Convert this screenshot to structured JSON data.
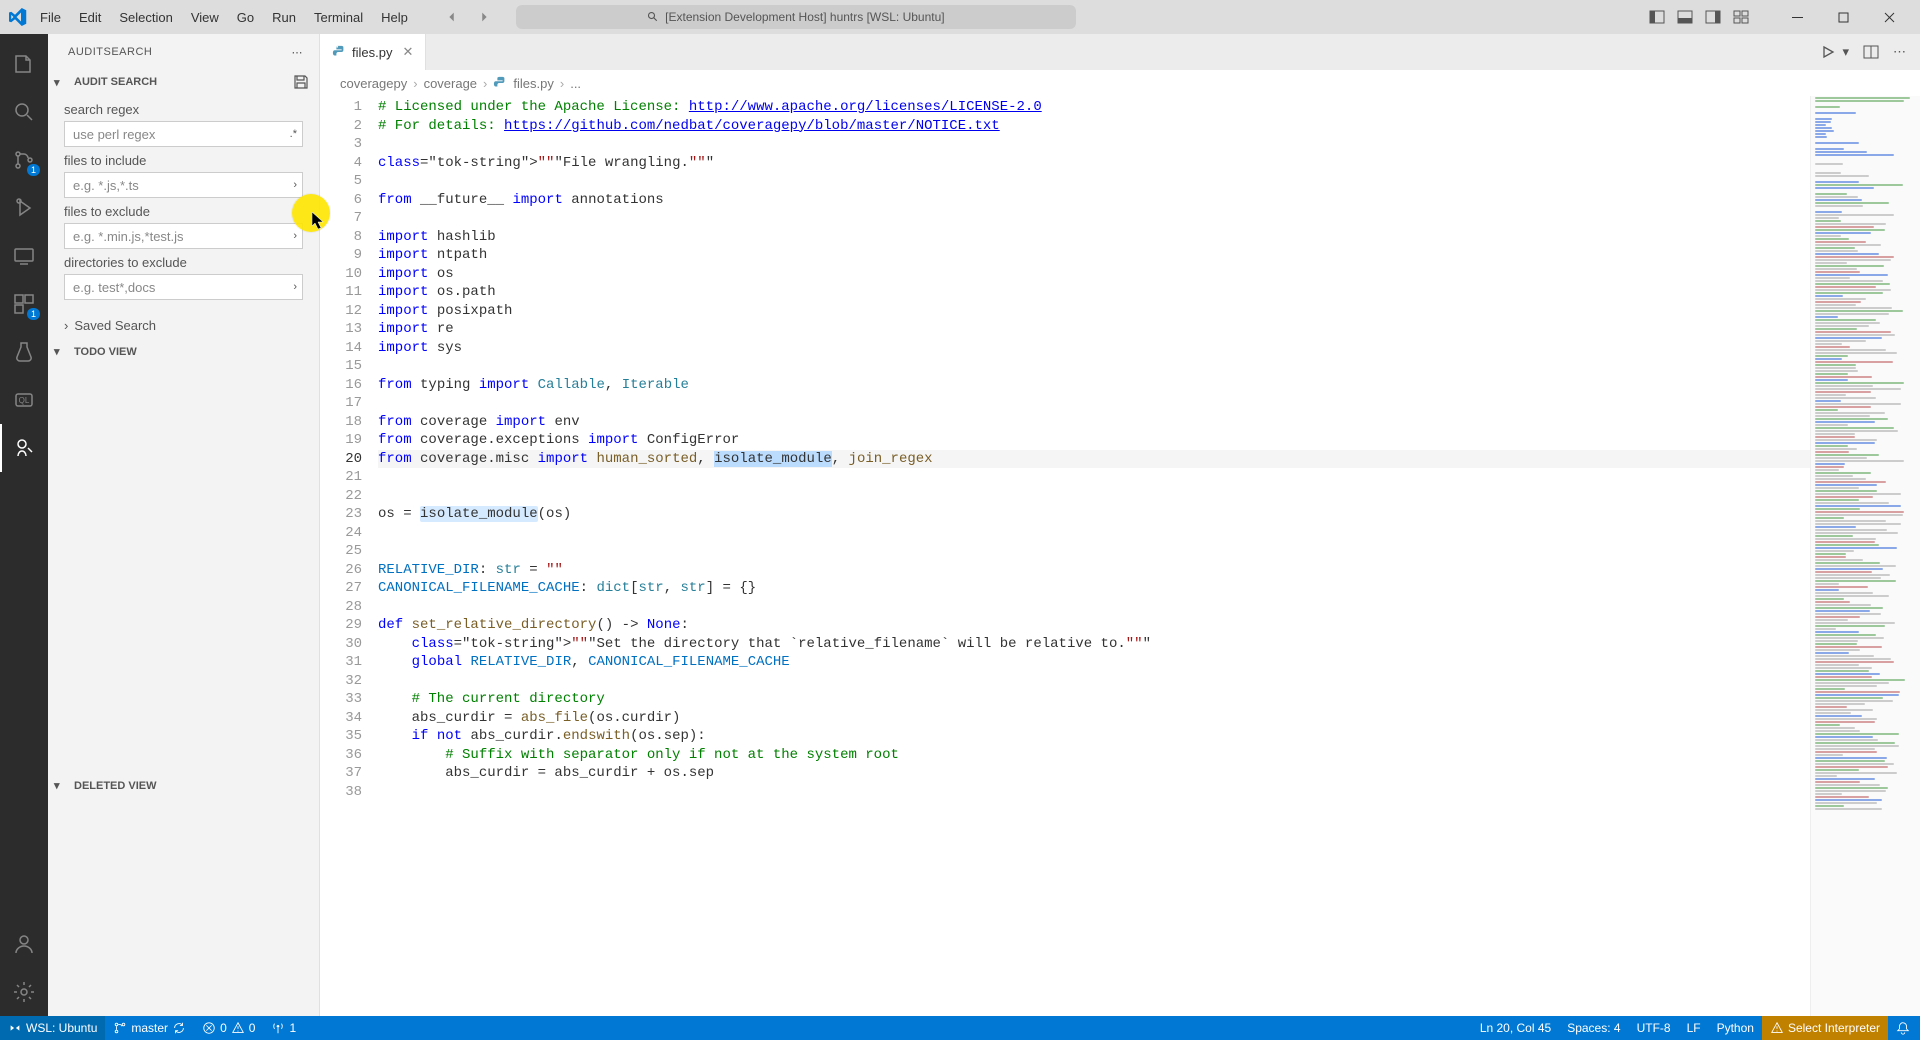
{
  "titlebar": {
    "menu": [
      "File",
      "Edit",
      "Selection",
      "View",
      "Go",
      "Run",
      "Terminal",
      "Help"
    ],
    "search_text": "[Extension Development Host] huntrs [WSL: Ubuntu]"
  },
  "sidebar": {
    "title": "AUDITSEARCH",
    "sections": {
      "audit_search": {
        "label": "AUDIT SEARCH",
        "fields": {
          "regex_label": "search regex",
          "regex_placeholder": "use perl regex",
          "include_label": "files to include",
          "include_placeholder": "e.g. *.js,*.ts",
          "exclude_files_label": "files to exclude",
          "exclude_files_placeholder": "e.g. *.min.js,*test.js",
          "exclude_dirs_label": "directories to exclude",
          "exclude_dirs_placeholder": "e.g. test*,docs"
        },
        "saved_search_label": "Saved Search"
      },
      "todo_view": {
        "label": "TODO VIEW"
      },
      "deleted_view": {
        "label": "DELETED VIEW"
      }
    }
  },
  "activitybar": {
    "scm_badge": "1",
    "ext_badge": "1"
  },
  "tabs": {
    "active": {
      "label": "files.py"
    }
  },
  "breadcrumb": {
    "items": [
      "coveragepy",
      "coverage",
      "files.py",
      "..."
    ]
  },
  "editor": {
    "lines": [
      38,
      1
    ],
    "current_line": 20
  },
  "statusbar": {
    "remote": "WSL: Ubuntu",
    "branch": "master",
    "errors": "0",
    "warnings": "0",
    "ports": "1",
    "cursor": "Ln 20, Col 45",
    "spaces": "Spaces: 4",
    "encoding": "UTF-8",
    "eol": "LF",
    "language": "Python",
    "interpreter": "Select Interpreter"
  },
  "chart_data": {
    "type": "table",
    "title": "files.py source",
    "rows": [
      {
        "n": 1,
        "text": "# Licensed under the Apache License: http://www.apache.org/licenses/LICENSE-2.0"
      },
      {
        "n": 2,
        "text": "# For details: https://github.com/nedbat/coveragepy/blob/master/NOTICE.txt"
      },
      {
        "n": 3,
        "text": ""
      },
      {
        "n": 4,
        "text": "\"\"\"File wrangling.\"\"\""
      },
      {
        "n": 5,
        "text": ""
      },
      {
        "n": 6,
        "text": "from __future__ import annotations"
      },
      {
        "n": 7,
        "text": ""
      },
      {
        "n": 8,
        "text": "import hashlib"
      },
      {
        "n": 9,
        "text": "import ntpath"
      },
      {
        "n": 10,
        "text": "import os"
      },
      {
        "n": 11,
        "text": "import os.path"
      },
      {
        "n": 12,
        "text": "import posixpath"
      },
      {
        "n": 13,
        "text": "import re"
      },
      {
        "n": 14,
        "text": "import sys"
      },
      {
        "n": 15,
        "text": ""
      },
      {
        "n": 16,
        "text": "from typing import Callable, Iterable"
      },
      {
        "n": 17,
        "text": ""
      },
      {
        "n": 18,
        "text": "from coverage import env"
      },
      {
        "n": 19,
        "text": "from coverage.exceptions import ConfigError"
      },
      {
        "n": 20,
        "text": "from coverage.misc import human_sorted, isolate_module, join_regex"
      },
      {
        "n": 21,
        "text": ""
      },
      {
        "n": 22,
        "text": ""
      },
      {
        "n": 23,
        "text": "os = isolate_module(os)"
      },
      {
        "n": 24,
        "text": ""
      },
      {
        "n": 25,
        "text": ""
      },
      {
        "n": 26,
        "text": "RELATIVE_DIR: str = \"\""
      },
      {
        "n": 27,
        "text": "CANONICAL_FILENAME_CACHE: dict[str, str] = {}"
      },
      {
        "n": 28,
        "text": ""
      },
      {
        "n": 29,
        "text": "def set_relative_directory() -> None:"
      },
      {
        "n": 30,
        "text": "    \"\"\"Set the directory that `relative_filename` will be relative to.\"\"\""
      },
      {
        "n": 31,
        "text": "    global RELATIVE_DIR, CANONICAL_FILENAME_CACHE"
      },
      {
        "n": 32,
        "text": ""
      },
      {
        "n": 33,
        "text": "    # The current directory"
      },
      {
        "n": 34,
        "text": "    abs_curdir = abs_file(os.curdir)"
      },
      {
        "n": 35,
        "text": "    if not abs_curdir.endswith(os.sep):"
      },
      {
        "n": 36,
        "text": "        # Suffix with separator only if not at the system root"
      },
      {
        "n": 37,
        "text": "        abs_curdir = abs_curdir + os.sep"
      },
      {
        "n": 38,
        "text": ""
      }
    ]
  }
}
